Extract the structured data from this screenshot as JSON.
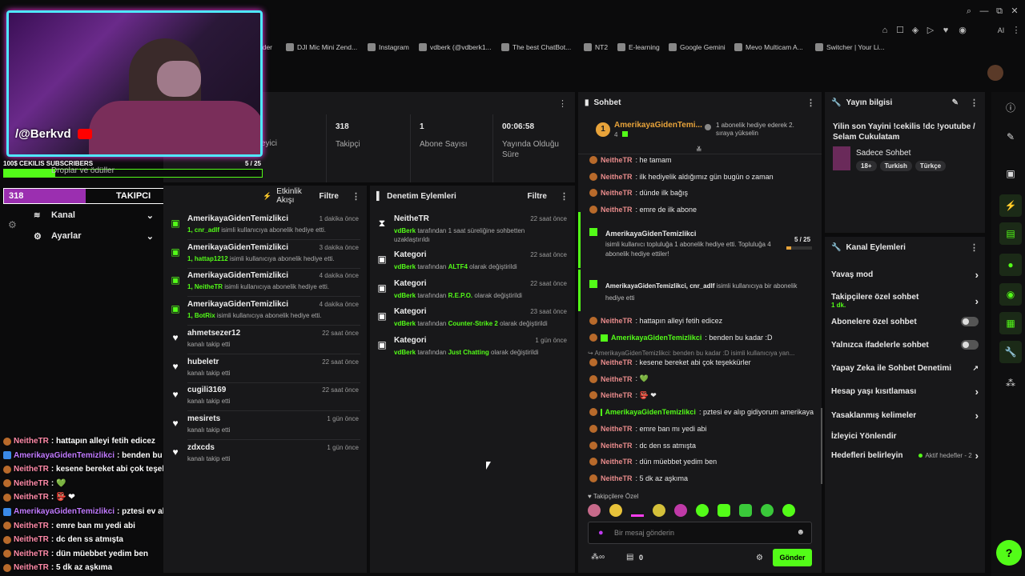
{
  "browser": {
    "bookmarks": [
      "ader",
      "DJI Mic Mini Zend...",
      "Instagram",
      "vdberk (@vdberk1...",
      "The best ChatBot...",
      "NT2",
      "E-learning",
      "Google Gemini",
      "Mevo Multicam A...",
      "Switcher | Your Li..."
    ],
    "controls": {
      "minimize": "—",
      "restore": "⧉",
      "close": "✕"
    }
  },
  "stats": {
    "partial_label": "eyici",
    "items": [
      {
        "value": "318",
        "label": "Takipçi"
      },
      {
        "value": "1",
        "label": "Abone Sayısı"
      },
      {
        "value": "00:06:58",
        "label": "Yayında Olduğu Süre"
      }
    ]
  },
  "sidebar": {
    "items": [
      {
        "label": "Kanal"
      },
      {
        "label": "Ayarlar"
      }
    ]
  },
  "overlay": {
    "handle": "/@Berkvd",
    "goal_title": "100$ CEKILIS SUBSCRIBERS",
    "goal_progress": "5  / 25",
    "goal_fraction": 0.2,
    "drops_label": "Droplar ve ödüller",
    "follower_count": "318",
    "follower_label": "TAKIPCI",
    "follower_goal": "1000",
    "follower_fraction": 0.318,
    "chat": [
      {
        "user": "NeitheTR",
        "text": ": hattapın alleyi fetih edicez",
        "color": "pink"
      },
      {
        "user": "AmerikayaGidenTemizlikci",
        "text": ": benden bu kadar :D",
        "color": "purple"
      },
      {
        "user": "NeitheTR",
        "text": ": kesene bereket abi çok teşekkürler",
        "color": "pink"
      },
      {
        "user": "NeitheTR",
        "text": ":  💚",
        "color": "pink"
      },
      {
        "user": "NeitheTR",
        "text": ":  👺 ❤",
        "color": "pink"
      },
      {
        "user": "AmerikayaGidenTemizlikci",
        "text": ": pztesi ev alıp gidiyorum amerikaya",
        "color": "purple"
      },
      {
        "user": "NeitheTR",
        "text": ": emre ban mı yedi abi",
        "color": "pink"
      },
      {
        "user": "NeitheTR",
        "text": ": dc den ss atmışta",
        "color": "pink"
      },
      {
        "user": "NeitheTR",
        "text": ": dün müebbet yedim ben",
        "color": "pink"
      },
      {
        "user": "NeitheTR",
        "text": ": 5 dk az aşkıma",
        "color": "pink"
      }
    ]
  },
  "activity": {
    "title": "Etkinlik Akışı",
    "filter": "Filtre",
    "items": [
      {
        "name": "AmerikayaGidenTemizlikci",
        "time": "1 dakika önce",
        "hl": "1, cnr_adlf",
        "sub": " isimli kullanıcıya abonelik hediye etti.",
        "icon": "gift"
      },
      {
        "name": "AmerikayaGidenTemizlikci",
        "time": "3 dakika önce",
        "hl": "1, hattap1212",
        "sub": " isimli kullanıcıya abonelik hediye etti.",
        "icon": "gift"
      },
      {
        "name": "AmerikayaGidenTemizlikci",
        "time": "4 dakika önce",
        "hl": "1, NeitheTR",
        "sub": " isimli kullanıcıya abonelik hediye etti.",
        "icon": "gift"
      },
      {
        "name": "AmerikayaGidenTemizlikci",
        "time": "4 dakika önce",
        "hl": "1, BotRix",
        "sub": " isimli kullanıcıya abonelik hediye etti.",
        "icon": "gift"
      },
      {
        "name": "ahmetsezer12",
        "time": "22 saat önce",
        "hl": "",
        "sub": "kanalı takip etti",
        "icon": "heart"
      },
      {
        "name": "hubeletr",
        "time": "22 saat önce",
        "hl": "",
        "sub": "kanalı takip etti",
        "icon": "heart"
      },
      {
        "name": "cugili3169",
        "time": "22 saat önce",
        "hl": "",
        "sub": "kanalı takip etti",
        "icon": "heart"
      },
      {
        "name": "mesirets",
        "time": "1 gün önce",
        "hl": "",
        "sub": "kanalı takip etti",
        "icon": "heart"
      },
      {
        "name": "zdxcds",
        "time": "1 gün önce",
        "hl": "",
        "sub": "kanalı takip etti",
        "icon": "heart"
      }
    ]
  },
  "moderation": {
    "title": "Denetim Eylemleri",
    "filter": "Filtre",
    "items": [
      {
        "name": "NeitheTR",
        "time": "22 saat önce",
        "hl": "vdBerk",
        "sub": " tarafından 1 saat süreliğine sohbetten uzaklaştırıldı",
        "sub2": "",
        "icon": "⧗"
      },
      {
        "name": "Kategori",
        "time": "22 saat önce",
        "hl": "vdBerk",
        "sub": " tarafından ",
        "hl2": "ALTF4",
        "sub2": " olarak değiştirildi",
        "icon": "▣"
      },
      {
        "name": "Kategori",
        "time": "22 saat önce",
        "hl": "vdBerk",
        "sub": " tarafından ",
        "hl2": "R.E.P.O.",
        "sub2": " olarak değiştirildi",
        "icon": "▣"
      },
      {
        "name": "Kategori",
        "time": "23 saat önce",
        "hl": "vdBerk",
        "sub": " tarafından ",
        "hl2": "Counter-Strike 2",
        "sub2": " olarak değiştirildi",
        "icon": "▣"
      },
      {
        "name": "Kategori",
        "time": "1 gün önce",
        "hl": "vdBerk",
        "sub": " tarafından ",
        "hl2": "Just Chatting",
        "sub2": " olarak değiştirildi",
        "icon": "▣"
      }
    ]
  },
  "chat": {
    "title": "Sohbet",
    "pinned": {
      "rank": "1",
      "user": "AmerikayaGidenTemi...",
      "count": "4",
      "note": "1 abonelik hediye ederek 2. sıraya yükselin"
    },
    "messages": [
      {
        "user": "NeitheTR",
        "text": ": he tamam"
      },
      {
        "user": "NeitheTR",
        "text": ": ilk hediyelik aldığımız gün bugün o zaman"
      },
      {
        "user": "NeitheTR",
        "text": ": dünde ilk bağış"
      },
      {
        "user": "NeitheTR",
        "text": ": emre de ilk abone"
      }
    ],
    "gift1": {
      "user": "AmerikayaGidenTemizlikci",
      "text": "isimli kullanıcı topluluğa 1 abonelik hediye etti. Topluluğa 4 abonelik hediye ettiler!",
      "progress": "5 / 25",
      "fraction": 0.2
    },
    "gift2": {
      "user": "AmerikayaGidenTemizlikci, cnr_adlf",
      "text": " isimli kullanıcıya bir abonelik hediye etti"
    },
    "messages2": [
      {
        "user": "NeitheTR",
        "text": ": hattapın alleyi fetih edicez",
        "g": false
      },
      {
        "user": "AmerikayaGidenTemizlikci",
        "text": ": benden bu kadar :D",
        "g": true
      }
    ],
    "reply_ref": "↪ AmerikayaGidenTemizlikci: benden bu kadar :D isimli kullanıcıya yan...",
    "messages3": [
      {
        "user": "NeitheTR",
        "text": ": kesene bereket abi çok teşekkürler",
        "g": false
      },
      {
        "user": "NeitheTR",
        "text": ": 💚",
        "g": false
      },
      {
        "user": "NeitheTR",
        "text": ": 👺 ❤",
        "g": false
      },
      {
        "user": "AmerikayaGidenTemizlikci",
        "text": ": pztesi ev alıp gidiyorum amerikaya",
        "g": true
      },
      {
        "user": "NeitheTR",
        "text": ": emre ban mı yedi abi",
        "g": false
      },
      {
        "user": "NeitheTR",
        "text": ": dc den ss atmışta",
        "g": false
      },
      {
        "user": "NeitheTR",
        "text": ": dün müebbet yedim ben",
        "g": false
      },
      {
        "user": "NeitheTR",
        "text": ": 5 dk az aşkıma",
        "g": false
      }
    ],
    "followers_only": "♥ Takipçilere Özel",
    "input_placeholder": "Bir mesaj gönderin",
    "send": "Gönder",
    "points": "0"
  },
  "stream_info": {
    "title": "Yayın bilgisi",
    "stream_title": "Yilin son Yayini !cekilis !dc !youtube / Selam Cukulatam",
    "category": "Sadece Sohbet",
    "tags": [
      "18+",
      "Turkish",
      "Türkçe"
    ]
  },
  "channel_actions": {
    "title": "Kanal Eylemleri",
    "rows": [
      {
        "label": "Yavaş mod",
        "type": "chev"
      },
      {
        "label": "Takipçilere özel sohbet",
        "sub": "1 dk.",
        "type": "chev"
      },
      {
        "label": "Abonelere özel sohbet",
        "type": "toggle"
      },
      {
        "label": "Yalnızca ifadelerle sohbet",
        "type": "toggle"
      },
      {
        "label": "Yapay Zeka ile Sohbet Denetimi",
        "type": "ext"
      },
      {
        "label": "Hesap yaşı kısıtlaması",
        "type": "chev"
      },
      {
        "label": "Yasaklanmış kelimeler",
        "type": "chev"
      },
      {
        "label": "İzleyici Yönlendir",
        "type": "none"
      },
      {
        "label": "Hedefleri belirleyin",
        "extra": "Aktif hedefler - 2",
        "type": "chev"
      }
    ]
  },
  "colors": {
    "accent": "#53fc18",
    "panel": "#18181a",
    "bg": "#0b0b0c"
  }
}
